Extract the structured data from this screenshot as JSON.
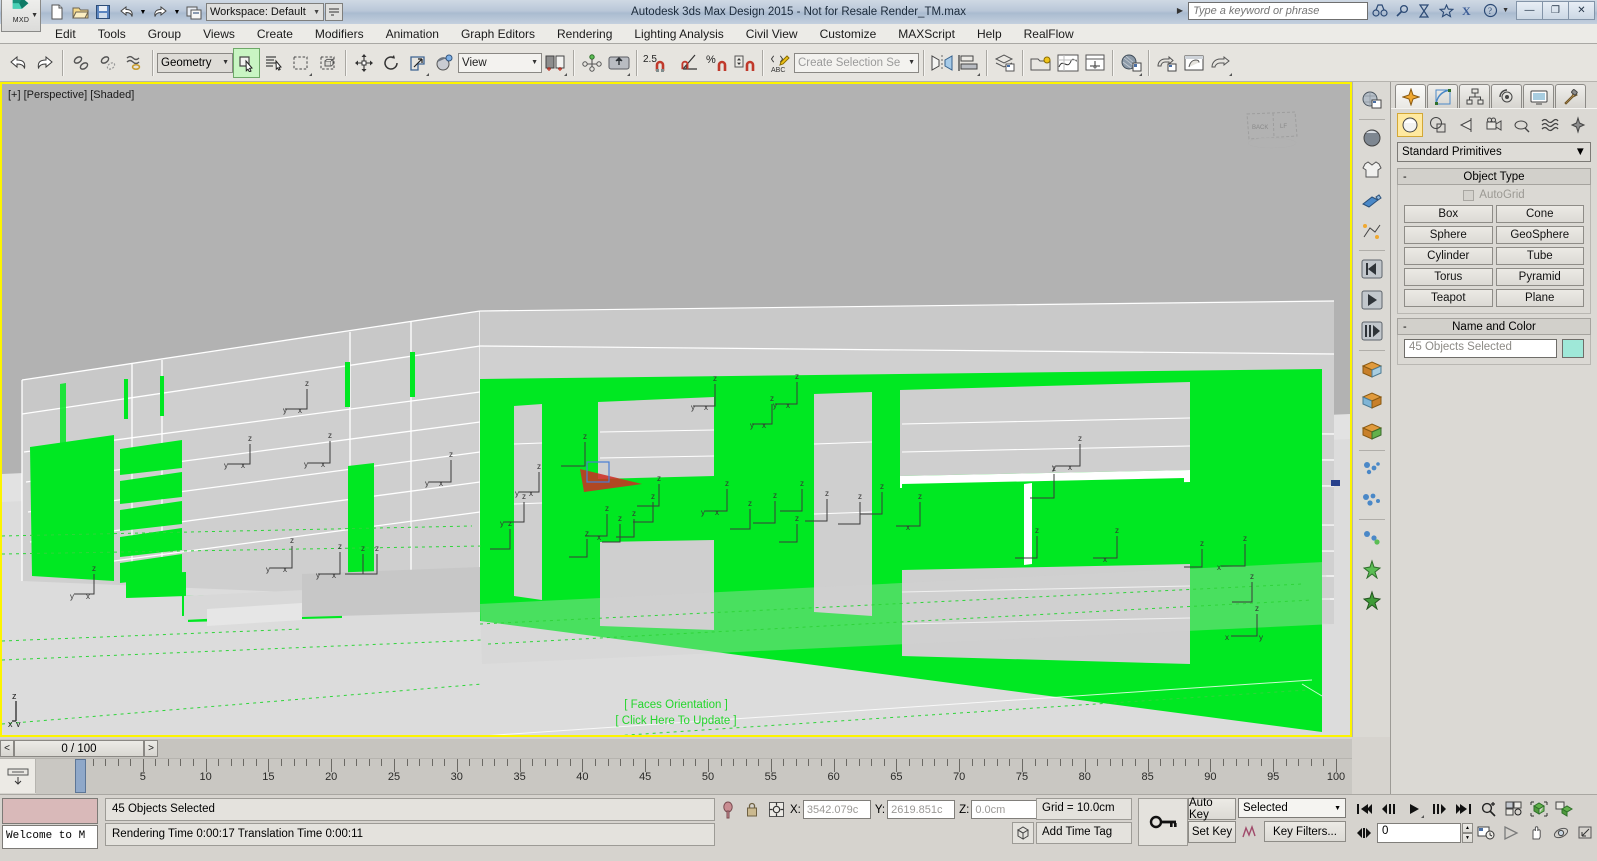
{
  "app": {
    "title": "Autodesk 3ds Max Design 2015  - Not for Resale    Render_TM.max",
    "logo_text": "MXD",
    "workspace_label": "Workspace: Default"
  },
  "search": {
    "placeholder": "Type a keyword or phrase"
  },
  "window_buttons": {
    "minimize": "—",
    "restore": "❐",
    "close": "✕"
  },
  "menu": {
    "items": [
      "Edit",
      "Tools",
      "Group",
      "Views",
      "Create",
      "Modifiers",
      "Animation",
      "Graph Editors",
      "Rendering",
      "Lighting Analysis",
      "Civil View",
      "Customize",
      "MAXScript",
      "Help",
      "RealFlow"
    ]
  },
  "toolbar": {
    "geometry_filter": "Geometry",
    "reference_coord": "View",
    "selection_set_placeholder": "Create Selection Se",
    "angle_snap_value": "2.5",
    "icons": [
      "undo-icon",
      "redo-icon",
      "select-link-icon",
      "unlink-icon",
      "bind-space-warp-icon",
      "select-object-icon",
      "select-by-name-icon",
      "rectangular-selection-icon",
      "window-crossing-icon",
      "select-move-icon",
      "select-rotate-icon",
      "select-scale-icon",
      "reference-coordinate-icon",
      "use-pivot-center-icon",
      "select-manipulate-icon",
      "snaps-toggle-icon",
      "angle-snap-icon",
      "percent-snap-icon",
      "spinner-snap-icon",
      "edit-named-selection-icon",
      "mirror-icon",
      "align-icon",
      "layer-manager-icon",
      "scene-explorer-icon",
      "curve-editor-icon",
      "schematic-view-icon",
      "material-editor-icon",
      "render-setup-icon",
      "rendered-frame-window-icon",
      "render-production-icon"
    ]
  },
  "viewport": {
    "label": "[+] [Perspective] [Shaded]",
    "faces_orientation": "[ Faces Orientation ]",
    "click_to_update": "[ Click Here To Update ]",
    "axis_x": "x",
    "axis_y": "y",
    "axis_z": "z",
    "viewcube_front": "BACK",
    "viewcube_side": "LEFT",
    "highlight_color": "#00e822",
    "background_color": "#b2b2b2",
    "border_color": "#fcf400"
  },
  "command_panel": {
    "tabs": [
      "create-tab",
      "modify-tab",
      "hierarchy-tab",
      "motion-tab",
      "display-tab",
      "utilities-tab"
    ],
    "category_icons": [
      "geometry-icon",
      "shapes-icon",
      "lights-icon",
      "cameras-icon",
      "helpers-icon",
      "space-warps-icon",
      "systems-icon"
    ],
    "subcategory": "Standard Primitives",
    "object_type": {
      "header": "Object Type",
      "autogrid_label": "AutoGrid",
      "buttons": [
        "Box",
        "Cone",
        "Sphere",
        "GeoSphere",
        "Cylinder",
        "Tube",
        "Torus",
        "Pyramid",
        "Teapot",
        "Plane"
      ]
    },
    "name_and_color": {
      "header": "Name and Color",
      "name_value": "45 Objects Selected",
      "color": "#9fe8d8"
    }
  },
  "viewport_tools": {
    "icons": [
      "scene-explorer-icon",
      "material-sphere-icon",
      "cloth-icon",
      "paint-deform-icon",
      "particle-flow-icon",
      "prev-frame-icon",
      "play-icon",
      "next-frame-icon",
      "render-box1-icon",
      "render-box2-icon",
      "render-box3-icon",
      "particles1-icon",
      "particles2-icon",
      "particles3-icon",
      "explosion1-icon",
      "explosion2-icon"
    ]
  },
  "time_slider": {
    "prev_label": "<",
    "next_label": ">",
    "frame_label": "0 / 100",
    "ruler_labels": [
      "5",
      "10",
      "15",
      "20",
      "25",
      "30",
      "35",
      "40",
      "45",
      "50",
      "55",
      "60",
      "65",
      "70",
      "75",
      "80",
      "85",
      "90",
      "95",
      "100"
    ],
    "ruler_max": 100,
    "current_frame": 0
  },
  "status_bar": {
    "welcome_text": "Welcome to M",
    "selection_status": "45 Objects Selected",
    "prompt": "Rendering Time  0:00:17     Translation Time  0:00:11",
    "coords": {
      "x_label": "X:",
      "x_value": "3542.079c",
      "y_label": "Y:",
      "y_value": "2619.851c",
      "z_label": "Z:",
      "z_value": "0.0cm"
    },
    "grid_text": "Grid = 10.0cm",
    "add_time_tag": "Add Time Tag",
    "auto_key": "Auto Key",
    "set_key": "Set Key",
    "key_mode": "Selected",
    "key_filters": "Key Filters...",
    "frame_field": "0",
    "nav_icons_row1": [
      "go-to-start-icon",
      "previous-frame-icon",
      "play-animation-icon",
      "next-frame-icon",
      "go-to-end-icon",
      "zoom-icon",
      "zoom-all-icon",
      "zoom-extents-icon",
      "zoom-extents-all-icon"
    ],
    "nav_icons_row2": [
      "key-mode-toggle-icon",
      "time-configuration-icon",
      "field-of-view-icon",
      "pan-view-icon",
      "orbit-icon",
      "maximize-viewport-icon"
    ]
  }
}
